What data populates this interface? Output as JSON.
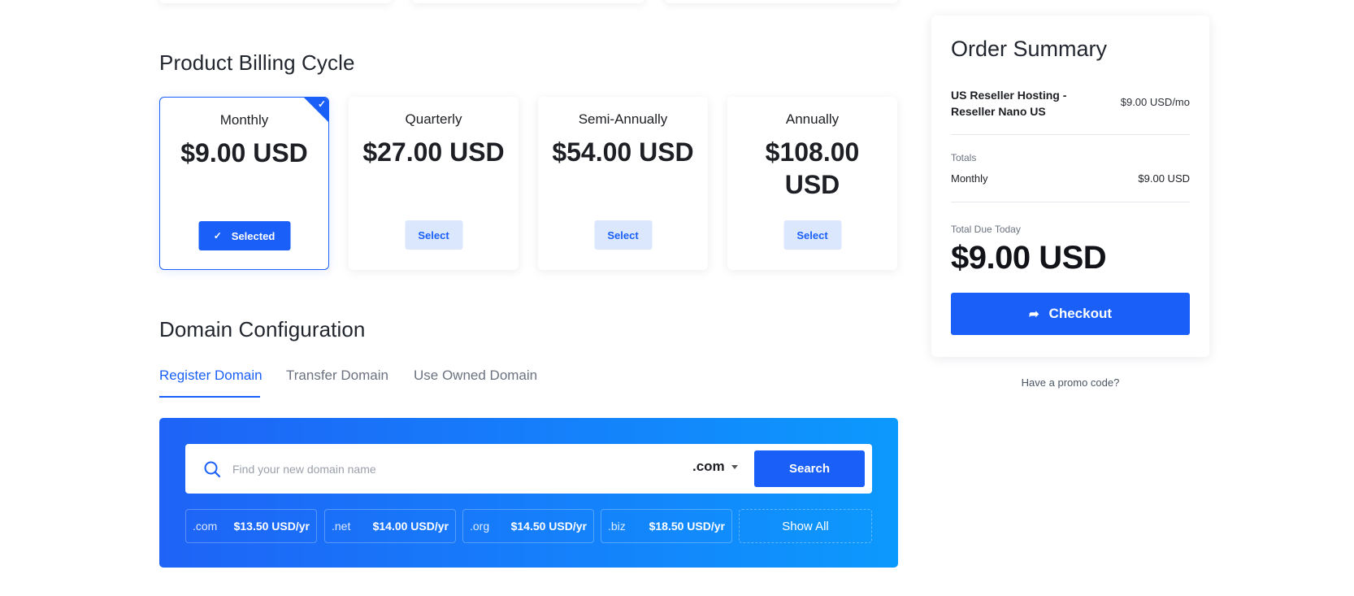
{
  "billing": {
    "title": "Product Billing Cycle",
    "cycles": [
      {
        "name": "Monthly",
        "price": "$9.00 USD",
        "button": "Selected"
      },
      {
        "name": "Quarterly",
        "price": "$27.00 USD",
        "button": "Select"
      },
      {
        "name": "Semi-Annually",
        "price": "$54.00 USD",
        "button": "Select"
      },
      {
        "name": "Annually",
        "price": "$108.00 USD",
        "button": "Select"
      }
    ],
    "selected_check": "✓"
  },
  "domain": {
    "title": "Domain Configuration",
    "tabs": [
      "Register Domain",
      "Transfer Domain",
      "Use Owned Domain"
    ],
    "search_placeholder": "Find your new domain name",
    "tld_selected": ".com",
    "search_button": "Search",
    "tlds": [
      {
        "ext": ".com",
        "price": "$13.50 USD/yr"
      },
      {
        "ext": ".net",
        "price": "$14.00 USD/yr"
      },
      {
        "ext": ".org",
        "price": "$14.50 USD/yr"
      },
      {
        "ext": ".biz",
        "price": "$18.50 USD/yr"
      }
    ],
    "show_all": "Show All"
  },
  "summary": {
    "title": "Order Summary",
    "item_name": "US Reseller Hosting - Reseller Nano US",
    "item_price": "$9.00 USD/mo",
    "totals_label": "Totals",
    "cycle_label": "Monthly",
    "cycle_amount": "$9.00 USD",
    "due_label": "Total Due Today",
    "due_amount": "$9.00 USD",
    "checkout_label": "Checkout",
    "checkout_icon": "➦",
    "promo": "Have a promo code?"
  },
  "colors": {
    "accent": "#1a5ff7",
    "light_accent": "#dbe7fd"
  }
}
